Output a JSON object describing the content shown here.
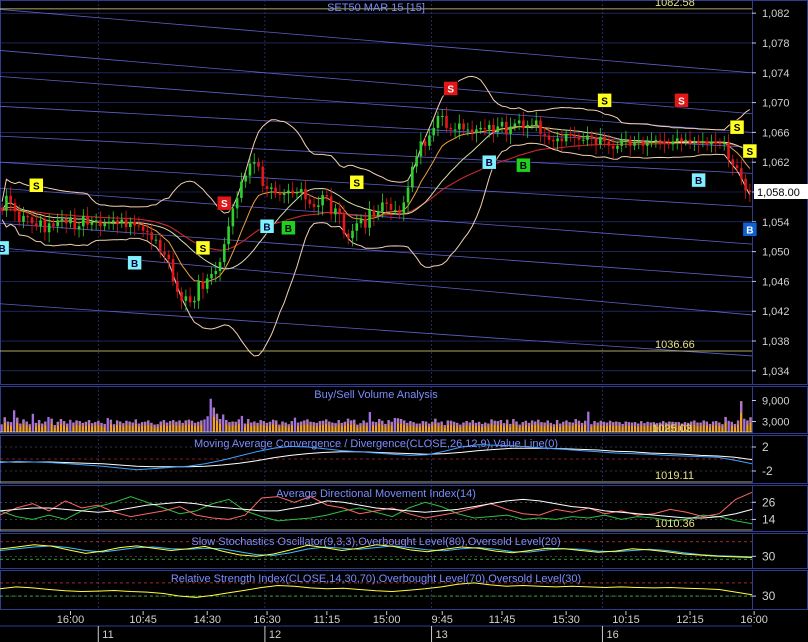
{
  "colors": {
    "background": "#000000",
    "frame": "#2e3b8f",
    "level_line": "#e6e080",
    "title_text": "#7b8cff",
    "price_up": "#2fd02f",
    "price_down": "#e01818",
    "bollinger": "#f2d0b0",
    "ma_fast": "#f0a040",
    "ma_slow": "#cc2a2a",
    "ma_mid": "#ddddaa",
    "trend_line": "#6a6adf",
    "volume_buy": "#f0a030",
    "volume_sell": "#a070e0",
    "macd_line": "#40a0ff",
    "macd_signal": "#ffffff",
    "adx": "#ffffff",
    "di_plus": "#ff6666",
    "di_minus": "#30c040",
    "stoch_k": "#ffff40",
    "stoch_d": "#40c0ff",
    "rsi": "#ffff40",
    "price_label_bg": "#ffffff",
    "sell_marker": "#ffff20",
    "sell_marker_alt": "#e060e0",
    "strong_sell_marker": "#e01818",
    "buy_marker": "#80f0ff",
    "strong_buy_marker": "#20d020",
    "buy_marker_dark": "#1060d0"
  },
  "chart_data": [
    {
      "type": "candlestick",
      "title": "SET50 MAR 15   [15]",
      "y_ticks": [
        1034,
        1038,
        1042,
        1046,
        1050,
        1054,
        1058,
        1062,
        1066,
        1070,
        1074,
        1078,
        1082
      ],
      "y_tick_labels": [
        "1,034",
        "1,038",
        "1,042",
        "1,046",
        "1,050",
        "1,054",
        "1,058",
        "1,062",
        "1,066",
        "1,070",
        "1,074",
        "1,078",
        "1,082"
      ],
      "ylim": [
        1032.5,
        1083.5
      ],
      "last_price_label": "1,058.00",
      "last_price": 1058.0,
      "level_labels": [
        {
          "text": "1082.58",
          "value": 1082.58
        },
        {
          "text": "1036.66",
          "value": 1036.66
        }
      ],
      "x_time_labels": [
        "16:00",
        "10:45",
        "14:30",
        "16:30",
        "11:15",
        "15:00",
        "9:45",
        "11:45",
        "15:30",
        "10:15",
        "12:15",
        "16:00"
      ],
      "x_time_index": [
        16,
        33,
        48,
        62,
        76,
        90,
        103,
        117,
        132,
        146,
        161,
        176
      ],
      "x_day_labels": [
        "11",
        "12",
        "13",
        "16"
      ],
      "x_day_index": [
        23,
        62,
        101,
        141
      ],
      "close_series": [
        1055.5,
        1057.5,
        1056.5,
        1055.4,
        1054.0,
        1054.8,
        1054.6,
        1053.8,
        1053.4,
        1054.2,
        1052.6,
        1053.8,
        1053.4,
        1054.2,
        1054.4,
        1053.8,
        1054.6,
        1053.0,
        1053.4,
        1054.8,
        1053.6,
        1054.0,
        1054.2,
        1053.4,
        1053.8,
        1054.0,
        1054.2,
        1053.8,
        1054.3,
        1053.3,
        1054.0,
        1053.5,
        1053.4,
        1052.8,
        1052.6,
        1051.6,
        1051.6,
        1050.0,
        1049.6,
        1049.0,
        1046.0,
        1044.6,
        1043.4,
        1044.0,
        1043.2,
        1043.4,
        1046.0,
        1045.0,
        1046.4,
        1047.0,
        1047.4,
        1048.6,
        1051.0,
        1053.4,
        1055.8,
        1057.2,
        1059.4,
        1060.2,
        1061.8,
        1062.0,
        1061.4,
        1058.8,
        1058.4,
        1058.6,
        1057.8,
        1057.6,
        1057.8,
        1058.2,
        1057.8,
        1058.0,
        1058.4,
        1057.0,
        1056.4,
        1056.0,
        1056.2,
        1057.6,
        1057.4,
        1055.0,
        1055.8,
        1055.0,
        1052.4,
        1051.8,
        1052.8,
        1053.8,
        1054.4,
        1053.2,
        1055.6,
        1054.8,
        1055.4,
        1056.6,
        1056.4,
        1055.6,
        1055.6,
        1055.2,
        1056.6,
        1058.6,
        1061.4,
        1062.8,
        1064.8,
        1064.2,
        1065.6,
        1066.6,
        1068.2,
        1068.2,
        1066.6,
        1066.4,
        1066.4,
        1067.2,
        1066.4,
        1066.4,
        1066.0,
        1066.4,
        1066.6,
        1066.4,
        1067.0,
        1066.0,
        1066.8,
        1067.4,
        1065.8,
        1066.8,
        1067.2,
        1067.6,
        1066.6,
        1067.0,
        1067.0,
        1067.6,
        1065.8,
        1065.6,
        1065.0,
        1064.8,
        1065.2,
        1064.8,
        1065.8,
        1065.6,
        1065.4,
        1065.0,
        1065.0,
        1065.6,
        1065.2,
        1064.4,
        1065.4,
        1064.8,
        1064.2,
        1063.8,
        1064.2,
        1065.0,
        1065.0,
        1064.2,
        1064.6,
        1064.8,
        1064.2,
        1064.6,
        1064.8,
        1065.0,
        1064.8,
        1064.6,
        1064.4,
        1064.8,
        1065.2,
        1064.8,
        1065.0,
        1064.6,
        1064.8,
        1064.6,
        1064.8,
        1064.4,
        1064.8,
        1064.6,
        1064.4,
        1064.6,
        1062.4,
        1061.6,
        1061.2,
        1059.8,
        1058.2,
        1058.0
      ],
      "signals": [
        {
          "type": "B",
          "i": 0,
          "below": true
        },
        {
          "type": "S",
          "i": 8,
          "below": false
        },
        {
          "type": "B",
          "i": 31,
          "below": true
        },
        {
          "type": "S",
          "i": 47,
          "below": false
        },
        {
          "type": "SR",
          "i": 52,
          "below": false
        },
        {
          "type": "B",
          "i": 62,
          "below": true
        },
        {
          "type": "BG",
          "i": 67,
          "below": true
        },
        {
          "type": "S",
          "i": 83,
          "below": false
        },
        {
          "type": "SR",
          "i": 105,
          "below": false
        },
        {
          "type": "B",
          "i": 114,
          "below": true
        },
        {
          "type": "BG",
          "i": 122,
          "below": true
        },
        {
          "type": "S",
          "i": 141,
          "below": false
        },
        {
          "type": "SR",
          "i": 159,
          "below": false
        },
        {
          "type": "B",
          "i": 163,
          "below": true
        },
        {
          "type": "S",
          "i": 172,
          "below": false
        },
        {
          "type": "B",
          "i": 188,
          "below": true
        },
        {
          "type": "S",
          "i": 196,
          "below": false
        },
        {
          "type": "SP",
          "i": 202,
          "below": false
        },
        {
          "type": "B",
          "i": 212,
          "below": true
        },
        {
          "type": "SP",
          "i": 217,
          "below": false
        },
        {
          "type": "S",
          "i": 220,
          "below": false
        },
        {
          "type": "B",
          "i": 225,
          "below": true
        },
        {
          "type": "S",
          "i": 228,
          "below": false
        },
        {
          "type": "SP",
          "i": 236,
          "below": false
        },
        {
          "type": "BD",
          "i": 236,
          "below": true
        },
        {
          "type": "S",
          "i": 240,
          "below": false
        }
      ]
    },
    {
      "type": "bar",
      "title": "Buy/Sell Volume Analysis",
      "y_tick_labels": [
        "9,000",
        "3,000"
      ],
      "y_ticks": [
        9000,
        3000
      ],
      "ylim": [
        0,
        12000
      ],
      "level_label": "1025.03",
      "volumes": [
        2200,
        4200,
        3000,
        2800,
        6200,
        4100,
        2400,
        3600,
        3000,
        2200,
        5200,
        2600,
        3400,
        2400,
        3000,
        4300,
        3800,
        2000,
        2900,
        3700,
        3100,
        2400,
        3500,
        2700,
        3300,
        3100,
        2600,
        2900,
        3400,
        2500,
        2800,
        3200,
        2600,
        2300,
        4000,
        3500,
        2200,
        3300,
        3000,
        2500,
        3200,
        3000,
        2700,
        3600,
        2400,
        2800,
        2900,
        3300,
        2600,
        2100,
        2200,
        3000,
        3400,
        2700,
        3100,
        3400,
        2900,
        3300,
        2600,
        3300,
        3500,
        3200,
        2600,
        2900,
        3300,
        3600,
        4500,
        9500,
        7000,
        5200,
        3700,
        5000,
        3400,
        2800,
        3000,
        2900,
        3600,
        4600,
        2400,
        3700,
        2700,
        3000,
        2600,
        3400,
        3100,
        2600,
        2900,
        3500,
        3300,
        2100,
        3000,
        2700,
        2200,
        3100,
        4100,
        2700,
        3000,
        3300,
        3600,
        2900,
        2800,
        2600,
        3100,
        3200,
        3600,
        3000,
        2700,
        2500,
        3400,
        2600,
        2900,
        3800,
        3300,
        3500,
        2100,
        2500,
        3300,
        2700,
        5700,
        3000,
        2800,
        3700,
        3200,
        2300,
        3400,
        2900,
        4000,
        3900,
        3700,
        3300,
        2600,
        3100,
        2800,
        2400,
        2400,
        3100,
        3000,
        2400,
        2900,
        3800,
        2700,
        3000,
        2000,
        3300,
        3200,
        2900,
        2600,
        2100,
        2700,
        3100,
        2700,
        3400,
        2600,
        2900,
        2300,
        2700,
        2400,
        3600,
        3200,
        3100,
        3400,
        2500,
        3500,
        2300,
        3700,
        3000,
        2100,
        2800,
        3200,
        2600,
        3300,
        3000,
        3500,
        2800,
        2700,
        3300,
        2600,
        2200,
        3400,
        2400,
        2900,
        3300,
        2800,
        2700,
        3700,
        3200,
        2600,
        3200,
        5800,
        2200,
        3100,
        2700,
        3200,
        2900,
        2700,
        3200,
        2800,
        3000,
        2800,
        2300,
        3000,
        2800,
        2700,
        2800,
        2400,
        3100,
        2500,
        2900,
        2700,
        2800,
        2500,
        2700,
        3100,
        2700,
        3000,
        2900,
        2800,
        2800,
        2400,
        2800,
        2600,
        3000,
        3300,
        2700,
        2700,
        3300,
        3000,
        2300,
        3000,
        3100,
        2700,
        2200,
        4300,
        3200,
        2900,
        2300,
        3300,
        8800,
        3800,
        3300,
        4200
      ],
      "sell_dominant": [
        1,
        0,
        0,
        0,
        1,
        0,
        0,
        0,
        0,
        0,
        1,
        0,
        0,
        0,
        0,
        1,
        0,
        0,
        0,
        0,
        0,
        0,
        1,
        0,
        0,
        0,
        0,
        0,
        0,
        0,
        0,
        0,
        0,
        0,
        1,
        0,
        0,
        0,
        0,
        0,
        0,
        0,
        0,
        0,
        0,
        0,
        0,
        0,
        0,
        0,
        0,
        0,
        0,
        0,
        0,
        0,
        0,
        0,
        0,
        0,
        0,
        0,
        0,
        0,
        0,
        1,
        1,
        1,
        0,
        0,
        0,
        1,
        0,
        0,
        0,
        0,
        0,
        1,
        0,
        0,
        0,
        0,
        0,
        0,
        0,
        0,
        0,
        0,
        0,
        0,
        0,
        0,
        0,
        0,
        1,
        0,
        0,
        0,
        0,
        0,
        0,
        0,
        0,
        0,
        0,
        0,
        0,
        0,
        0,
        0,
        0,
        0,
        0,
        0,
        0,
        0,
        0,
        0,
        1,
        0,
        0,
        0,
        0,
        0,
        0,
        0,
        1,
        0,
        0,
        0,
        0,
        0,
        0,
        0,
        0,
        0,
        0,
        0,
        0,
        0,
        0,
        0,
        0,
        0,
        0,
        0,
        0,
        0,
        0,
        0,
        0,
        0,
        0,
        0,
        0,
        0,
        0,
        0,
        0,
        0,
        0,
        0,
        0,
        0,
        0,
        0,
        0,
        0,
        0,
        0,
        0,
        0,
        0,
        0,
        0,
        0,
        0,
        0,
        0,
        0,
        0,
        0,
        0,
        0,
        0,
        0,
        0,
        0,
        1,
        0,
        0,
        0,
        0,
        0,
        0,
        0,
        0,
        0,
        0,
        0,
        0,
        0,
        0,
        0,
        0,
        0,
        0,
        0,
        0,
        0,
        0,
        0,
        0,
        0,
        0,
        0,
        0,
        0,
        0,
        0,
        0,
        0,
        0,
        0,
        0,
        0,
        0,
        0,
        0,
        0,
        0,
        0,
        0,
        1,
        0,
        0,
        0,
        0,
        1,
        0,
        0,
        1
      ]
    },
    {
      "type": "line",
      "title": "Moving Average Convergence / Divergence(CLOSE,26,12,9),Value Line(0)",
      "y_tick_labels": [
        "2",
        "-2"
      ],
      "y_ticks": [
        2,
        -2
      ],
      "ylim": [
        -3.5,
        3.5
      ],
      "level_label": "1019.11",
      "macd": [
        -0.6,
        -0.4,
        -0.5,
        -0.6,
        -0.8,
        -1.0,
        -1.2,
        -1.5,
        -1.8,
        -1.6,
        -1.4,
        -1.2,
        -0.8,
        -0.2,
        0.5,
        1.2,
        1.8,
        2.1,
        2.0,
        1.7,
        1.4,
        1.2,
        1.0,
        0.8,
        0.6,
        0.7,
        1.3,
        2.0,
        2.4,
        2.3,
        2.2,
        2.0,
        1.8,
        1.6,
        1.4,
        1.2,
        1.0,
        0.9,
        0.8,
        0.6,
        0.5,
        0.4,
        0.3,
        -0.2,
        -0.8
      ],
      "signal": [
        -0.5,
        -0.5,
        -0.5,
        -0.5,
        -0.6,
        -0.7,
        -0.8,
        -1.0,
        -1.2,
        -1.3,
        -1.3,
        -1.3,
        -1.2,
        -1.0,
        -0.7,
        -0.3,
        0.2,
        0.6,
        0.9,
        1.1,
        1.2,
        1.2,
        1.1,
        1.0,
        0.9,
        0.8,
        0.9,
        1.1,
        1.4,
        1.6,
        1.8,
        1.8,
        1.8,
        1.7,
        1.6,
        1.5,
        1.3,
        1.2,
        1.0,
        0.9,
        0.8,
        0.6,
        0.5,
        0.3,
        -0.1
      ]
    },
    {
      "type": "line",
      "title": "Average Directional Movement Index(14)",
      "y_tick_labels": [
        "26",
        "14"
      ],
      "y_ticks": [
        26,
        14
      ],
      "ylim": [
        8,
        36
      ],
      "level_label": "1010.36",
      "adx": [
        20,
        21,
        22,
        22,
        21,
        20,
        19,
        20,
        22,
        24,
        25,
        26,
        25,
        23,
        22,
        21,
        20,
        20,
        22,
        24,
        27,
        26,
        24,
        22,
        21,
        20,
        19,
        20,
        21,
        23,
        25,
        27,
        28,
        27,
        25,
        23,
        22,
        20,
        19,
        18,
        17,
        16,
        15,
        15,
        16,
        18,
        21
      ],
      "di_plus": [
        17,
        22,
        25,
        20,
        27,
        22,
        24,
        19,
        16,
        18,
        20,
        23,
        17,
        15,
        14,
        17,
        29,
        30,
        26,
        30,
        24,
        22,
        18,
        20,
        22,
        18,
        15,
        17,
        19,
        22,
        25,
        21,
        18,
        17,
        21,
        19,
        22,
        18,
        20,
        17,
        18,
        21,
        19,
        16,
        18,
        28,
        33
      ],
      "di_minus": [
        20,
        16,
        14,
        17,
        14,
        20,
        23,
        26,
        30,
        26,
        22,
        18,
        20,
        25,
        28,
        20,
        16,
        13,
        14,
        15,
        17,
        20,
        22,
        19,
        16,
        22,
        26,
        23,
        18,
        15,
        16,
        17,
        14,
        15,
        14,
        16,
        15,
        17,
        14,
        16,
        15,
        13,
        14,
        17,
        16,
        13,
        11
      ]
    },
    {
      "type": "line",
      "title": "Slow Stochastics Oscillator(9,3,3),Overbought Level(80),Oversold Level(20)",
      "y_tick_labels": [
        "30"
      ],
      "y_ticks": [
        30
      ],
      "ylim": [
        0,
        100
      ],
      "overbought": 80,
      "oversold": 20,
      "k": [
        55,
        62,
        70,
        65,
        52,
        40,
        48,
        60,
        66,
        58,
        50,
        56,
        64,
        48,
        35,
        30,
        38,
        52,
        68,
        60,
        50,
        58,
        70,
        64,
        52,
        46,
        54,
        62,
        58,
        48,
        42,
        50,
        58,
        56,
        50,
        44,
        48,
        56,
        52,
        46,
        38,
        34,
        30,
        28,
        26
      ],
      "d": [
        50,
        56,
        62,
        66,
        60,
        50,
        45,
        52,
        60,
        62,
        56,
        54,
        58,
        56,
        46,
        36,
        33,
        42,
        55,
        62,
        58,
        54,
        60,
        66,
        60,
        52,
        49,
        56,
        60,
        54,
        46,
        45,
        52,
        56,
        54,
        48,
        46,
        50,
        54,
        50,
        42,
        36,
        32,
        30,
        28
      ]
    },
    {
      "type": "line",
      "title": "Relative Strength Index(CLOSE,14,30,70),Overbought Level(70),Oversold Level(30)",
      "y_tick_labels": [
        "30"
      ],
      "y_ticks": [
        30
      ],
      "ylim": [
        0,
        100
      ],
      "overbought": 70,
      "oversold": 30,
      "rsi": [
        52,
        58,
        55,
        50,
        46,
        44,
        45,
        47,
        44,
        42,
        38,
        30,
        26,
        32,
        40,
        48,
        56,
        62,
        60,
        55,
        52,
        54,
        50,
        46,
        44,
        48,
        52,
        58,
        66,
        70,
        64,
        60,
        62,
        60,
        58,
        60,
        58,
        56,
        58,
        56,
        55,
        56,
        54,
        52,
        50,
        42,
        34
      ]
    }
  ]
}
